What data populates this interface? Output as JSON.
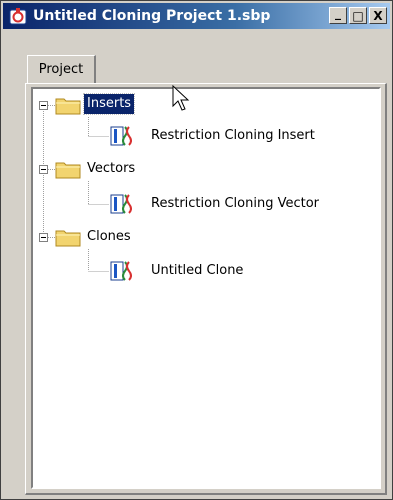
{
  "window": {
    "title": "Untitled Cloning Project 1.sbp",
    "buttons": {
      "minimize": "_",
      "maximize": "□",
      "close": "X"
    }
  },
  "tabs": [
    {
      "label": "Project",
      "active": true
    }
  ],
  "tree": {
    "nodes": [
      {
        "label": "Inserts",
        "type": "folder",
        "expanded": true,
        "selected": true,
        "children": [
          {
            "label": "Restriction Cloning Insert",
            "type": "sequence"
          }
        ]
      },
      {
        "label": "Vectors",
        "type": "folder",
        "expanded": true,
        "selected": false,
        "children": [
          {
            "label": "Restriction Cloning Vector",
            "type": "sequence"
          }
        ]
      },
      {
        "label": "Clones",
        "type": "folder",
        "expanded": true,
        "selected": false,
        "children": [
          {
            "label": "Untitled Clone",
            "type": "sequence"
          }
        ]
      }
    ]
  },
  "colors": {
    "titlebar_start": "#0a246a",
    "titlebar_end": "#a6caf0",
    "selection": "#0a246a",
    "folder": "#f2d46f"
  }
}
